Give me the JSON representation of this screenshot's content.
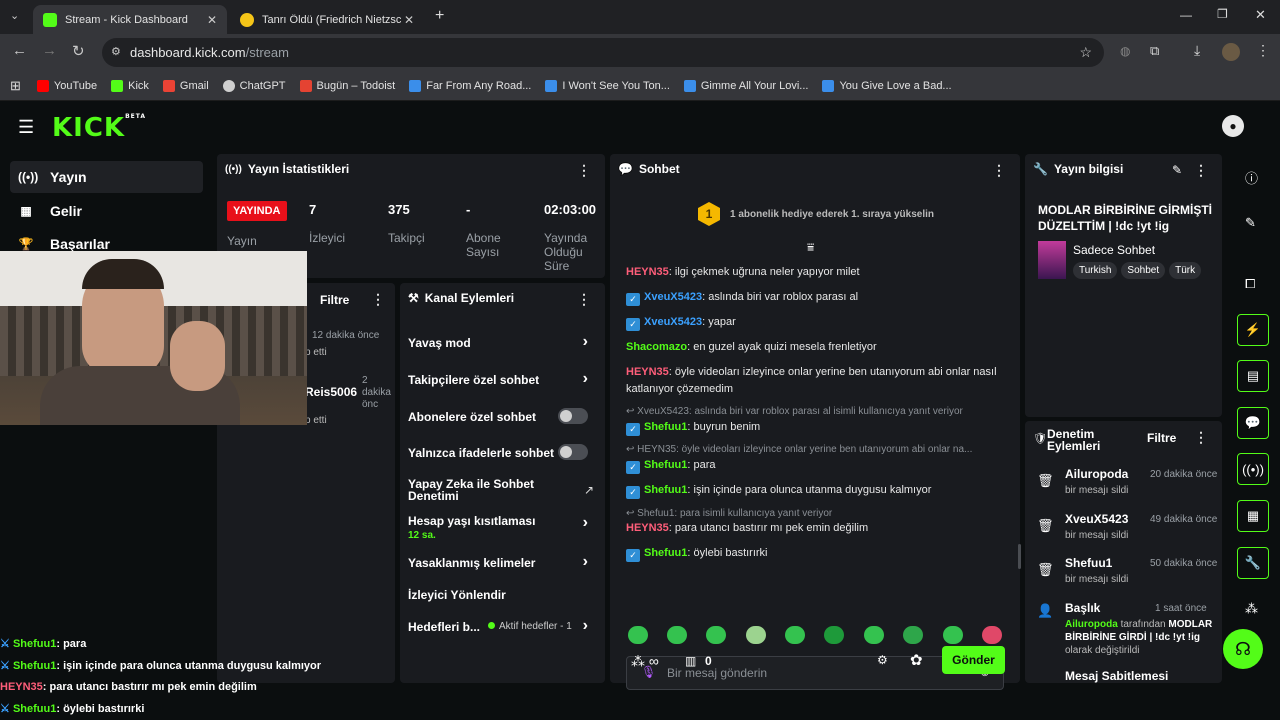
{
  "browser": {
    "tabs": [
      {
        "title": "Stream - Kick Dashboard",
        "active": true,
        "fav_color": "#53fc18"
      },
      {
        "title": "Tanrı Öldü (Friedrich Nietzsche)",
        "active": false,
        "fav_color": "#f5c518"
      }
    ],
    "url_host": "dashboard.kick.com",
    "url_path": "/stream",
    "bookmarks": [
      {
        "label": "YouTube",
        "color": "#ff0000"
      },
      {
        "label": "Kick",
        "color": "#53fc18"
      },
      {
        "label": "Gmail",
        "color": "#ea4335"
      },
      {
        "label": "ChatGPT",
        "color": "#cfcfcf"
      },
      {
        "label": "Bugün – Todoist",
        "color": "#e44332"
      },
      {
        "label": "Far From Any Road...",
        "color": "#3b8eea"
      },
      {
        "label": "I Won't See You Ton...",
        "color": "#3b8eea"
      },
      {
        "label": "Gimme All Your Lovi...",
        "color": "#3b8eea"
      },
      {
        "label": "You Give Love a Bad...",
        "color": "#3b8eea"
      }
    ]
  },
  "app": {
    "logo": "KICK",
    "logo_beta": "BETA",
    "accent": "#53fc18",
    "sidebar": [
      {
        "label": "Yayın",
        "icon": "broadcast-icon"
      },
      {
        "label": "Gelir",
        "icon": "chart-icon"
      },
      {
        "label": "Başarılar",
        "icon": "trophy-icon"
      }
    ],
    "stats": {
      "title": "Yayın İstatistikleri",
      "live_badge": "YAYINDA",
      "live_label": "Yayın",
      "viewers_value": "7",
      "viewers_label": "İzleyici",
      "followers_value": "375",
      "followers_label": "Takipçi",
      "subs_value": "-",
      "subs_label": "Abone Sayısı",
      "duration_value": "02:03:00",
      "duration_label": "Yayında Olduğu Süre"
    },
    "activity": {
      "filter": "Filtre",
      "items": [
        {
          "time": "12 dakika önce",
          "text": "p etti"
        },
        {
          "user": "Reis5006",
          "time": "2 dakika önc",
          "text": "p etti"
        }
      ]
    },
    "channel_actions": {
      "title": "Kanal Eylemleri",
      "items": [
        {
          "label": "Yavaş mod"
        },
        {
          "label": "Takipçilere özel sohbet"
        },
        {
          "label": "Abonelere özel sohbet"
        },
        {
          "label": "Yalnızca ifadelerle sohbet"
        },
        {
          "label": "Yapay Zeka ile Sohbet Denetimi"
        },
        {
          "label": "Hesap yaşı kısıtlaması",
          "sub": "12 sa."
        },
        {
          "label": "Yasaklanmış kelimeler"
        },
        {
          "label": "İzleyici Yönlendir"
        },
        {
          "label": "Hedefleri b...",
          "sub": "Aktif hedefler - 1"
        }
      ]
    },
    "chat": {
      "title": "Sohbet",
      "banner_rank": "1",
      "banner": "1 abonelik hediye ederek 1. sıraya yükselin",
      "messages": [
        {
          "user": "HEYN35",
          "text": "ilgi çekmek uğruna neler yapıyor milet",
          "color": "#ff5e7a"
        },
        {
          "user": "XveuX5423",
          "text": "aslında biri var roblox parası al",
          "color": "#3ba1ff"
        },
        {
          "user": "XveuX5423",
          "text": "yapar",
          "color": "#3ba1ff"
        },
        {
          "user": "Shacomazo",
          "text": "en guzel ayak quizi mesela frenletiyor",
          "color": "#53fc18"
        },
        {
          "user": "HEYN35",
          "text": "öyle videoları izleyince onlar yerine ben utanıyorum abi onlar nasıl katlanıyor çözemedim",
          "color": "#ff5e7a"
        },
        {
          "reply": "XveuX5423: aslında biri var roblox parası al isimli kullanıcıya yanıt veriyor"
        },
        {
          "user": "Shefuu1",
          "text": "buyrun benim",
          "color": "#53fc18"
        },
        {
          "reply": "HEYN35: öyle videoları izleyince onlar yerine ben utanıyorum abi onlar na..."
        },
        {
          "user": "Shefuu1",
          "text": "para",
          "color": "#53fc18"
        },
        {
          "user": "Shefuu1",
          "text": "işin içinde para olunca utanma duygusu kalmıyor",
          "color": "#53fc18"
        },
        {
          "reply": "Shefuu1: para isimli kullanıcıya yanıt veriyor"
        },
        {
          "user": "HEYN35",
          "text": "para utancı bastırır mı pek emin değilim",
          "color": "#ff5e7a"
        },
        {
          "user": "Shefuu1",
          "text": "öylebi bastırırki",
          "color": "#53fc18"
        }
      ],
      "input_placeholder": "Bir mesaj gönderin",
      "points": "0",
      "send": "Gönder"
    },
    "stream_info": {
      "title": "Yayın bilgisi",
      "stream_title": "MODLAR BİRBİRİNE GİRMİŞTİ DÜZELTTİM | !dc !yt !ig",
      "category": "Sadece Sohbet",
      "tags": [
        "Turkish",
        "Sohbet",
        "Türk"
      ]
    },
    "mod_actions": {
      "title": "Denetim Eylemleri",
      "filter": "Filtre",
      "items": [
        {
          "user": "Ailuropoda",
          "time": "20 dakika önce",
          "text": "bir mesajı sildi"
        },
        {
          "user": "XveuX5423",
          "time": "49 dakika önce",
          "text": "bir mesajı sildi"
        },
        {
          "user": "Shefuu1",
          "time": "50 dakika önce",
          "text": "bir mesajı sildi"
        }
      ],
      "title_change": {
        "label": "Başlık",
        "time": "1 saat önce",
        "user": "Ailuropoda",
        "mid": "tarafından",
        "value": "MODLAR BİRBİRİNE GİRDİ | !dc !yt !ig",
        "end": "olarak değiştirildi"
      },
      "cut": "Mesaj Sabitlemesi"
    }
  },
  "overlay_chat": [
    {
      "user": "Shefuu1",
      "text": "para",
      "color": "#53fc18"
    },
    {
      "user": "Shefuu1",
      "text": "işin içinde para olunca utanma duygusu kalmıyor",
      "color": "#53fc18"
    },
    {
      "user": "HEYN35",
      "text": "para utancı bastırır mı pek emin değilim",
      "color": "#ff5e7a"
    },
    {
      "user": "Shefuu1",
      "text": "öylebi bastırırki",
      "color": "#53fc18"
    }
  ]
}
